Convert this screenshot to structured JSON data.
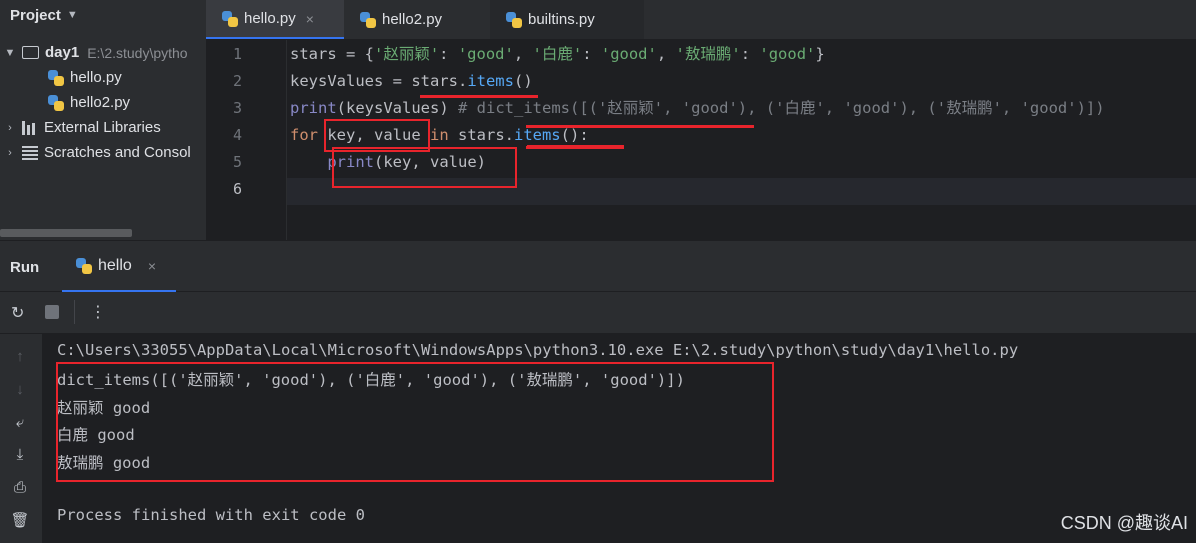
{
  "project": {
    "title": "Project",
    "root": {
      "name": "day1",
      "path": "E:\\2.study\\pytho"
    },
    "files": [
      "hello.py",
      "hello2.py"
    ],
    "external": "External Libraries",
    "scratches": "Scratches and Consol"
  },
  "tabs": [
    {
      "label": "hello.py",
      "close": "×"
    },
    {
      "label": "hello2.py"
    },
    {
      "label": "builtins.py"
    }
  ],
  "editor": {
    "line_numbers": [
      "1",
      "2",
      "3",
      "4",
      "5",
      "6"
    ],
    "line1": {
      "a": "stars = {",
      "k1": "'赵丽颖'",
      "c1": ": ",
      "v1": "'good'",
      "s1": ", ",
      "k2": "'白鹿'",
      "c2": ": ",
      "v2": "'good'",
      "s2": ", ",
      "k3": "'敖瑞鹏'",
      "c3": ": ",
      "v3": "'good'",
      "e": "}"
    },
    "line2": {
      "a": "keysValues = stars.",
      "m": "items",
      "e": "()"
    },
    "line3": {
      "p": "print",
      "a": "(keysValues) ",
      "c": "# dict_items([('赵丽颖', 'good'), ('白鹿', 'good'), ('敖瑞鹏', 'good')])"
    },
    "line4": {
      "for": "for",
      "a": " key, value ",
      "in": "in",
      "b": " stars.",
      "m": "items",
      "e": "():"
    },
    "line5": {
      "indent": "    ",
      "p": "print",
      "a": "(key, value)"
    }
  },
  "run": {
    "title": "Run",
    "tab": "hello",
    "close": "×",
    "output": [
      "C:\\Users\\33055\\AppData\\Local\\Microsoft\\WindowsApps\\python3.10.exe E:\\2.study\\python\\study\\day1\\hello.py",
      "dict_items([('赵丽颖', 'good'), ('白鹿', 'good'), ('敖瑞鹏', 'good')])",
      "赵丽颖 good",
      "白鹿 good",
      "敖瑞鹏 good",
      "",
      "Process finished with exit code 0"
    ]
  },
  "watermark": "CSDN @趣谈AI",
  "colors": {
    "annotation": "#e8242c",
    "accent": "#3574f0",
    "keyword": "#cf8e6d",
    "string": "#6aab73",
    "method": "#56a8f5",
    "comment": "#7a7e85"
  }
}
